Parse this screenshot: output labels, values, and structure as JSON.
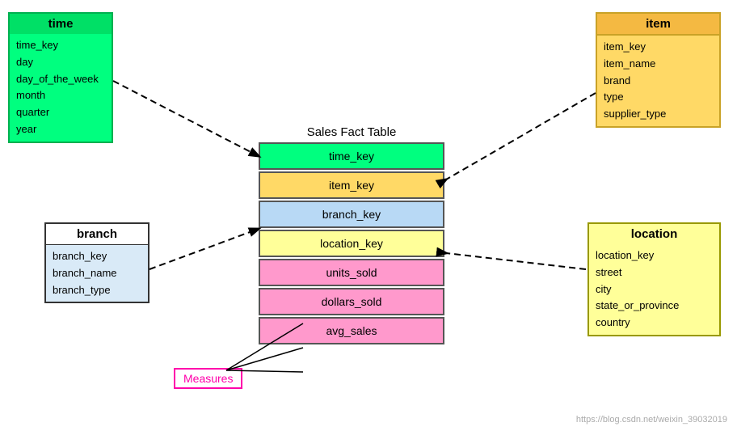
{
  "time_table": {
    "header": "time",
    "fields": [
      "time_key",
      "day",
      "day_of_the_week",
      "month",
      "quarter",
      "year"
    ]
  },
  "item_table": {
    "header": "item",
    "fields": [
      "item_key",
      "item_name",
      "brand",
      "type",
      "supplier_type"
    ]
  },
  "branch_table": {
    "header": "branch",
    "fields": [
      "branch_key",
      "branch_name",
      "branch_type"
    ]
  },
  "location_table": {
    "header": "location",
    "fields": [
      "location_key",
      "street",
      "city",
      "state_or_province",
      "country"
    ]
  },
  "sales_fact": {
    "title": "Sales Fact Table",
    "rows": [
      {
        "label": "time_key",
        "color": "green"
      },
      {
        "label": "item_key",
        "color": "orange"
      },
      {
        "label": "branch_key",
        "color": "blue"
      },
      {
        "label": "location_key",
        "color": "yellow"
      },
      {
        "label": "units_sold",
        "color": "pink"
      },
      {
        "label": "dollars_sold",
        "color": "pink"
      },
      {
        "label": "avg_sales",
        "color": "pink"
      }
    ]
  },
  "measures": {
    "label": "Measures"
  },
  "watermark": "https://blog.csdn.net/weixin_39032019"
}
